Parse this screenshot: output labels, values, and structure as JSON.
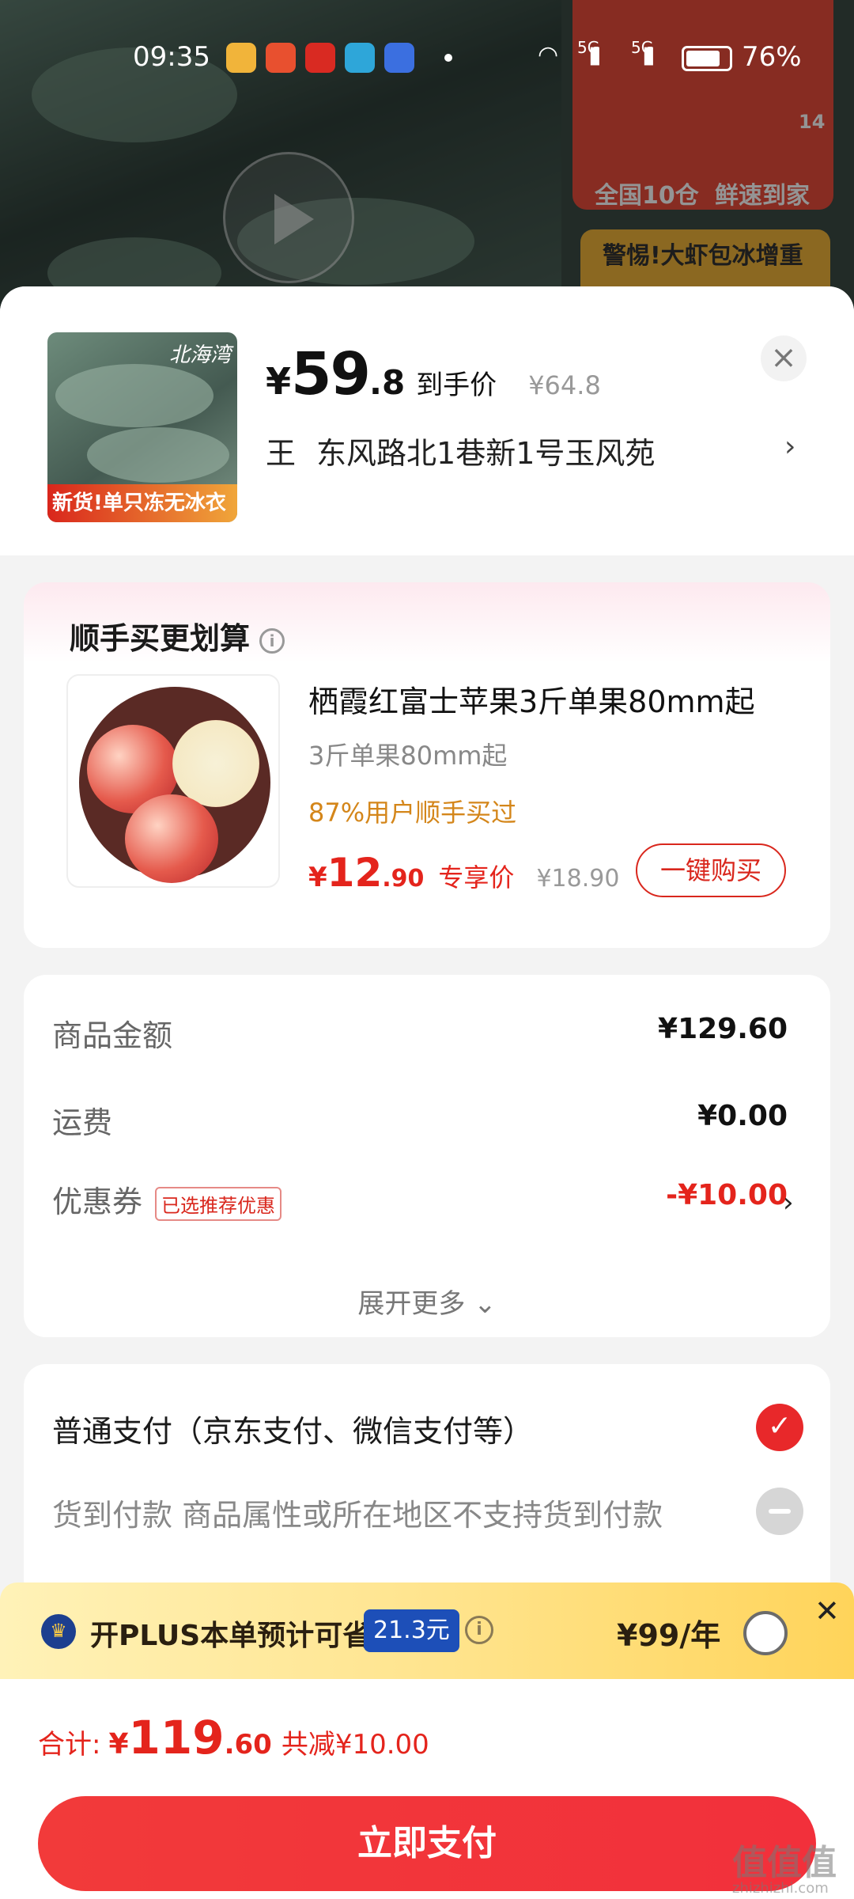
{
  "status_bar": {
    "time": "09:35",
    "network_1": "5G",
    "network_2": "5G",
    "battery_pct": "76%"
  },
  "background": {
    "side_banner_1": "全国10仓",
    "side_banner_2": "鲜速到家",
    "side_banner_3": "警惕!大虾包冰增重",
    "side_badge": "14"
  },
  "product": {
    "badge": "新货!单只冻无冰衣",
    "logo": "北海湾",
    "price_symbol": "¥",
    "price_int": "59",
    "price_dec": ".8",
    "price_tag": "到手价",
    "old_price": "¥64.8",
    "close_glyph": "×"
  },
  "address": {
    "name": "王",
    "text": "东风路北1巷新1号玉风苑",
    "chevron": "›"
  },
  "addon": {
    "title": "顺手买更划算",
    "info_glyph": "i",
    "name": "栖霞红富士苹果3斤单果80mm起",
    "spec": "3斤单果80mm起",
    "social": "87%用户顺手买过",
    "price_symbol": "¥",
    "price_int": "12",
    "price_dec": ".90",
    "price_tag": "专享价",
    "old_price": "¥18.90",
    "buy_label": "一键购买"
  },
  "amounts": {
    "goods_label": "商品金额",
    "goods_value": "¥129.60",
    "shipping_label": "运费",
    "shipping_value": "¥0.00",
    "coupon_label": "优惠券",
    "coupon_tag": "已选推荐优惠",
    "coupon_value": "-¥10.00",
    "coupon_chevron": "›",
    "expand_label": "展开更多 ⌄"
  },
  "payment": {
    "option_normal": "普通支付（京东支付、微信支付等）",
    "option_normal_selected": true,
    "option_cod": "货到付款   商品属性或所在地区不支持货到付款",
    "check_glyph": "✓"
  },
  "plus": {
    "crown_glyph": "♛",
    "text": "开PLUS本单预计可省",
    "save_amount": "21.3元",
    "info_glyph": "i",
    "price": "¥99/年",
    "close_glyph": "✕"
  },
  "bottom": {
    "total_label": "合计:",
    "total_symbol": "¥",
    "total_int": "119",
    "total_dec": ".60",
    "saving": "共减¥10.00",
    "pay_label": "立即支付"
  },
  "watermark": {
    "text": "值值值",
    "sub": "zhizhizhi.com"
  },
  "colors": {
    "accent_red": "#e4241c",
    "pay_button": "#f23a3a",
    "social_orange": "#d4861a",
    "plus_blue": "#1d4fb8"
  }
}
